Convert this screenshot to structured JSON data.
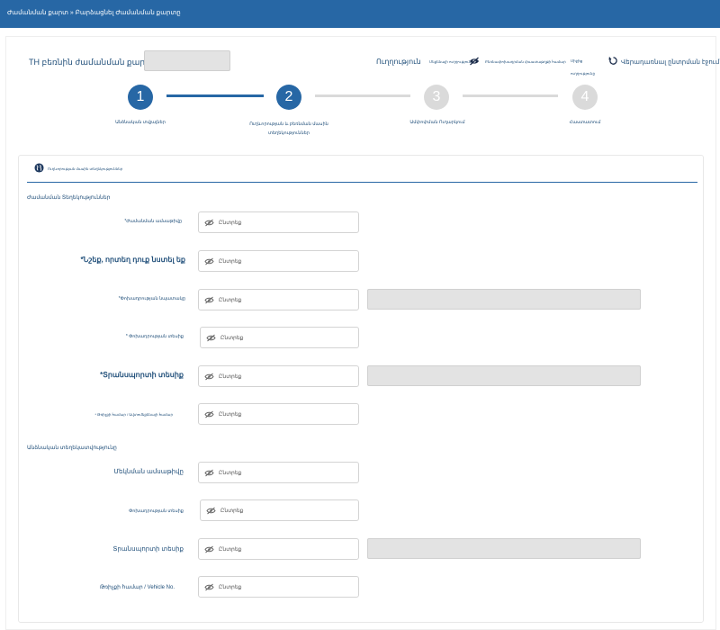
{
  "breadcrumb": "Ժամանման քարտ » Բարձացնել Ժամանման քարտը",
  "header": {
    "card_number_label": "TH բեռնին ժամանման քարտ No.",
    "direction_label": "Ուղղություն",
    "tiny_1": "Մեքենայի ուղղություն",
    "tiny_2": "Բեռնափոխադրման փաստաթղթի համար",
    "tiny_3": "Միջից",
    "tiny_4": "ուղղությունը",
    "refresh_label": "Վերադառնալ ընտրման էջում"
  },
  "stepper": {
    "steps": [
      {
        "number": "1",
        "label": "Անձնական տվյալներ"
      },
      {
        "number": "2",
        "label": "Ուղևորության և բեռնման մասին տեղեկություններ"
      },
      {
        "number": "3",
        "label": "Ամփոփման Ուղարկում"
      },
      {
        "number": "4",
        "label": "Հաստատում"
      }
    ]
  },
  "card": {
    "title": "Ուղևորության մասին տեղեկություններ"
  },
  "sections": {
    "arrival": "Ժամանման Տեղեկություններ",
    "personal": "Անձնական տեղեկատվությունը"
  },
  "fields": [
    {
      "label": "*Ժամանման ամսաթիվը",
      "placeholder": "Ընտրեք"
    },
    {
      "label": "*Նշեք, որտեղ դուք նստել եք",
      "placeholder": "Ընտրեք"
    },
    {
      "label": "*Փոխադրության նպատակը",
      "placeholder": "Ընտրեք"
    },
    {
      "label": "* Փոխադրության տեսիք",
      "placeholder": "Ընտրեք"
    },
    {
      "label": "*Տրանսպորտի տեսիք",
      "placeholder": "Ընտրեք"
    },
    {
      "label": "* Թռիչքի համար / Ավտոմեքենայի համար",
      "placeholder": "Ընտրեք"
    },
    {
      "label": "Մեկնման ամսաթիվը",
      "placeholder": "Ընտրեք"
    },
    {
      "label": "Փոխադրության տեսիք",
      "placeholder": "Ընտրեք"
    },
    {
      "label": "Տրանսպորտի տեսիք",
      "placeholder": "Ընտրեք"
    },
    {
      "label": "Թռիչքի համար / Vehicle No.",
      "placeholder": "Ընտրեք"
    }
  ],
  "colors": {
    "primary": "#2767a5",
    "inactive": "#dadada",
    "text": "#1f4e79"
  }
}
